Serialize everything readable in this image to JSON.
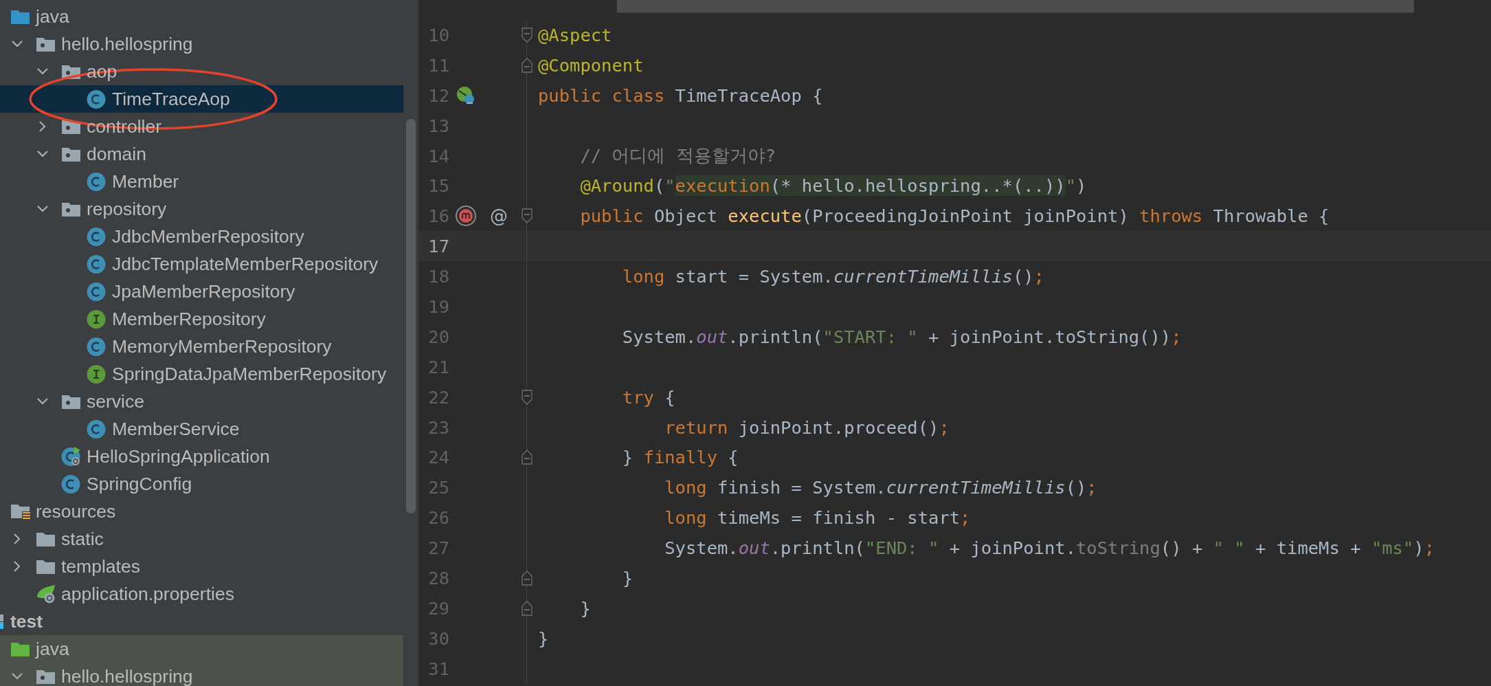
{
  "tree": [
    {
      "name": "java",
      "kind": "source-folder",
      "selected": false,
      "circled": false,
      "children": [
        {
          "name": "hello.hellospring",
          "kind": "package",
          "expanded": true,
          "selected": false,
          "circled": false,
          "children": [
            {
              "name": "aop",
              "kind": "package",
              "expanded": true,
              "selected": false,
              "circled": false,
              "children": [
                {
                  "name": "TimeTraceAop",
                  "kind": "class",
                  "selected": true,
                  "circled": true
                }
              ]
            },
            {
              "name": "controller",
              "kind": "package",
              "expanded": false,
              "selected": false,
              "circled": false
            },
            {
              "name": "domain",
              "kind": "package",
              "expanded": true,
              "selected": false,
              "circled": false,
              "children": [
                {
                  "name": "Member",
                  "kind": "class",
                  "selected": false,
                  "circled": false
                }
              ]
            },
            {
              "name": "repository",
              "kind": "package",
              "expanded": true,
              "selected": false,
              "circled": false,
              "children": [
                {
                  "name": "JdbcMemberRepository",
                  "kind": "class",
                  "selected": false,
                  "circled": false
                },
                {
                  "name": "JdbcTemplateMemberRepository",
                  "kind": "class",
                  "selected": false,
                  "circled": false
                },
                {
                  "name": "JpaMemberRepository",
                  "kind": "class",
                  "selected": false,
                  "circled": false
                },
                {
                  "name": "MemberRepository",
                  "kind": "interface",
                  "selected": false,
                  "circled": false
                },
                {
                  "name": "MemoryMemberRepository",
                  "kind": "class",
                  "selected": false,
                  "circled": false
                },
                {
                  "name": "SpringDataJpaMemberRepository",
                  "kind": "interface",
                  "selected": false,
                  "circled": false
                }
              ]
            },
            {
              "name": "service",
              "kind": "package",
              "expanded": true,
              "selected": false,
              "circled": false,
              "children": [
                {
                  "name": "MemberService",
                  "kind": "class",
                  "selected": false,
                  "circled": false
                }
              ]
            },
            {
              "name": "HelloSpringApplication",
              "kind": "spring-app",
              "selected": false,
              "circled": false
            },
            {
              "name": "SpringConfig",
              "kind": "class",
              "selected": false,
              "circled": false
            }
          ]
        }
      ]
    },
    {
      "name": "resources",
      "kind": "resources-folder",
      "selected": false,
      "circled": false,
      "children": [
        {
          "name": "static",
          "kind": "folder",
          "expanded": false,
          "selected": false,
          "circled": false
        },
        {
          "name": "templates",
          "kind": "folder",
          "expanded": false,
          "selected": false,
          "circled": false
        },
        {
          "name": "application.properties",
          "kind": "properties",
          "selected": false,
          "circled": false
        }
      ]
    },
    {
      "name": "test",
      "kind": "test-root",
      "selected": false,
      "circled": false,
      "children": [
        {
          "name": "java",
          "kind": "test-source-folder",
          "selected": false,
          "circled": false,
          "children": [
            {
              "name": "hello.hellospring",
              "kind": "package",
              "expanded": true,
              "selected": false,
              "circled": false
            }
          ]
        }
      ]
    }
  ],
  "editor": {
    "lines": [
      {
        "number": "10",
        "current": false,
        "fold": {
          "kind": "start"
        },
        "tokens": [
          {
            "kind": "ann",
            "text": "@Aspect"
          }
        ]
      },
      {
        "number": "11",
        "current": false,
        "fold": {
          "kind": "end"
        },
        "tokens": [
          {
            "kind": "ann",
            "text": "@Component"
          }
        ]
      },
      {
        "number": "12",
        "current": false,
        "marker": {
          "kind": "bean"
        },
        "tokens": [
          {
            "kind": "kw",
            "text": "public class "
          },
          {
            "kind": "plain",
            "text": "TimeTraceAop {"
          }
        ]
      },
      {
        "number": "13",
        "current": false
      },
      {
        "number": "14",
        "current": false,
        "tokens": [
          {
            "kind": "cmt",
            "text": "    // 어디에 적용할거야?"
          }
        ]
      },
      {
        "number": "15",
        "current": false,
        "tokens": [
          {
            "kind": "ann",
            "text": "    @Around"
          },
          {
            "kind": "plain",
            "text": "("
          },
          {
            "kind": "str",
            "text": "\""
          },
          {
            "kind": "injkw",
            "text": "execution"
          },
          {
            "kind": "inj",
            "text": "(* hello.hellospring..*(..))"
          },
          {
            "kind": "str",
            "text": "\""
          },
          {
            "kind": "plain",
            "text": ")"
          }
        ]
      },
      {
        "number": "16",
        "current": false,
        "marker": {
          "kind": "override"
        },
        "gutter_text": "@",
        "fold": {
          "kind": "start"
        },
        "tokens": [
          {
            "kind": "kw",
            "text": "    public "
          },
          {
            "kind": "plain",
            "text": "Object "
          },
          {
            "kind": "fn",
            "text": "execute"
          },
          {
            "kind": "plain",
            "text": "(ProceedingJoinPoint joinPoint) "
          },
          {
            "kind": "kw",
            "text": "throws "
          },
          {
            "kind": "plain",
            "text": "Throwable {"
          }
        ]
      },
      {
        "number": "17",
        "current": true
      },
      {
        "number": "18",
        "current": false,
        "tokens": [
          {
            "kind": "kw",
            "text": "        long "
          },
          {
            "kind": "plain",
            "text": "start = System."
          },
          {
            "kind": "static",
            "text": "currentTimeMillis"
          },
          {
            "kind": "plain",
            "text": "()"
          },
          {
            "kind": "kw",
            "text": ";"
          }
        ]
      },
      {
        "number": "19",
        "current": false
      },
      {
        "number": "20",
        "current": false,
        "tokens": [
          {
            "kind": "plain",
            "text": "        System."
          },
          {
            "kind": "field",
            "text": "out"
          },
          {
            "kind": "plain",
            "text": ".println("
          },
          {
            "kind": "str",
            "text": "\"START: \""
          },
          {
            "kind": "plain",
            "text": " + joinPoint.toString())"
          },
          {
            "kind": "kw",
            "text": ";"
          }
        ]
      },
      {
        "number": "21",
        "current": false
      },
      {
        "number": "22",
        "current": false,
        "fold": {
          "kind": "start"
        },
        "tokens": [
          {
            "kind": "kw",
            "text": "        try "
          },
          {
            "kind": "plain",
            "text": "{"
          }
        ]
      },
      {
        "number": "23",
        "current": false,
        "tokens": [
          {
            "kind": "kw",
            "text": "            return "
          },
          {
            "kind": "plain",
            "text": "joinPoint.proceed()"
          },
          {
            "kind": "kw",
            "text": ";"
          }
        ]
      },
      {
        "number": "24",
        "current": false,
        "fold": {
          "kind": "end"
        },
        "tokens": [
          {
            "kind": "plain",
            "text": "        } "
          },
          {
            "kind": "kw",
            "text": "finally "
          },
          {
            "kind": "plain",
            "text": "{"
          }
        ]
      },
      {
        "number": "25",
        "current": false,
        "tokens": [
          {
            "kind": "kw",
            "text": "            long "
          },
          {
            "kind": "plain",
            "text": "finish = System."
          },
          {
            "kind": "static",
            "text": "currentTimeMillis"
          },
          {
            "kind": "plain",
            "text": "()"
          },
          {
            "kind": "kw",
            "text": ";"
          }
        ]
      },
      {
        "number": "26",
        "current": false,
        "tokens": [
          {
            "kind": "kw",
            "text": "            long "
          },
          {
            "kind": "plain",
            "text": "timeMs = finish - start"
          },
          {
            "kind": "kw",
            "text": ";"
          }
        ]
      },
      {
        "number": "27",
        "current": false,
        "tokens": [
          {
            "kind": "plain",
            "text": "            System."
          },
          {
            "kind": "field",
            "text": "out"
          },
          {
            "kind": "plain",
            "text": ".println("
          },
          {
            "kind": "str",
            "text": "\"END: \""
          },
          {
            "kind": "plain",
            "text": " + joinPoint."
          },
          {
            "kind": "dim",
            "text": "toString"
          },
          {
            "kind": "plain",
            "text": "() + "
          },
          {
            "kind": "str",
            "text": "\" \""
          },
          {
            "kind": "plain",
            "text": " + timeMs + "
          },
          {
            "kind": "str",
            "text": "\"ms\""
          },
          {
            "kind": "plain",
            "text": ")"
          },
          {
            "kind": "kw",
            "text": ";"
          }
        ]
      },
      {
        "number": "28",
        "current": false,
        "fold": {
          "kind": "end"
        },
        "tokens": [
          {
            "kind": "plain",
            "text": "        }"
          }
        ]
      },
      {
        "number": "29",
        "current": false,
        "fold": {
          "kind": "end"
        },
        "tokens": [
          {
            "kind": "plain",
            "text": "    }"
          }
        ]
      },
      {
        "number": "30",
        "current": false,
        "tokens": [
          {
            "kind": "plain",
            "text": "}"
          }
        ]
      },
      {
        "number": "31",
        "current": false
      }
    ]
  }
}
